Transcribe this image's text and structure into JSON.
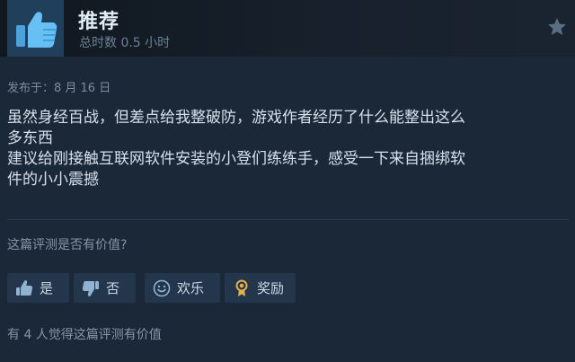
{
  "review": {
    "verdict": "推荐",
    "hours": "总时数 0.5 小时",
    "posted": "发布于：8 月 16 日",
    "body_lines": [
      "虽然身经百战，但差点给我整破防，游戏作者经历了什么能整出这么",
      "多东西",
      "建议给刚接触互联网软件安装的小登们练练手，感受一下来自捆绑软",
      "件的小小震撼"
    ]
  },
  "feedback": {
    "question": "这篇评测是否有价值?",
    "yes_label": "是",
    "no_label": "否",
    "funny_label": "欢乐",
    "award_label": "奖励",
    "helpful_count_text": "有 4 人觉得这篇评测有价值"
  },
  "icons": {
    "verdict": "thumbs-up-icon",
    "star": "star-icon",
    "yes": "thumbs-up-icon",
    "no": "thumbs-down-icon",
    "funny": "smiley-icon",
    "award": "award-icon"
  },
  "colors": {
    "background": "#1b2838",
    "thumb_tile": "#1f3f5b",
    "thumb_icon": "#66c0f4",
    "button_bg": "#23364b",
    "award_gold": "#e3b04b"
  }
}
